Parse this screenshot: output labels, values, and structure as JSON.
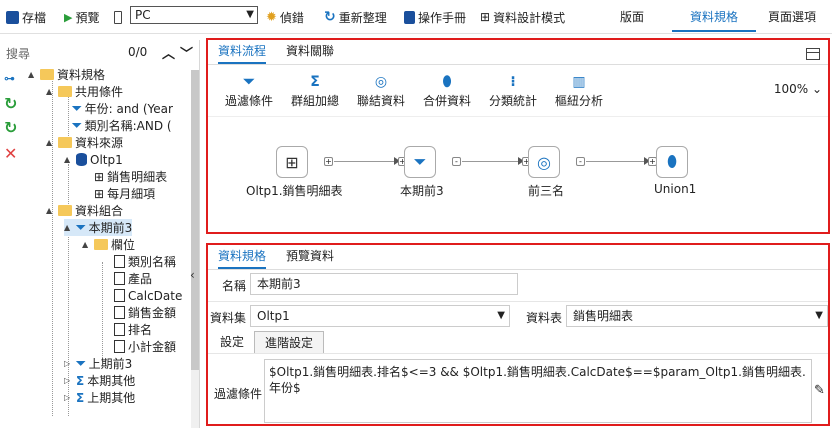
{
  "toolbar": {
    "save": "存檔",
    "preview": "預覽",
    "device": "PC",
    "debug": "偵錯",
    "refresh": "重新整理",
    "manual": "操作手冊",
    "design_mode": "資料設計模式",
    "right_tabs": [
      "版面",
      "資料規格",
      "頁面選項"
    ]
  },
  "left": {
    "search_placeholder": "搜尋",
    "count": "0/0",
    "tree": {
      "root": "資料規格",
      "common": "共用條件",
      "cond1": "年份: and (Year",
      "cond2": "類別名稱:AND (",
      "source": "資料來源",
      "oltp": "Oltp1",
      "table1": "銷售明細表",
      "table2": "每月細項",
      "combo": "資料組合",
      "top3": "本期前3",
      "fields": "欄位",
      "f1": "類別名稱",
      "f2": "產品",
      "f3": "CalcDate",
      "f4": "銷售金額",
      "f5": "排名",
      "f6": "小計金額",
      "prev3": "上期前3",
      "other": "本期其他",
      "prevother": "上期其他"
    }
  },
  "flow_panel": {
    "tabs": [
      "資料流程",
      "資料關聯"
    ],
    "tools": [
      "過濾條件",
      "群組加總",
      "聯結資料",
      "合併資料",
      "分類統計",
      "樞紐分析"
    ],
    "zoom": "100%",
    "nodes": [
      "Oltp1.銷售明細表",
      "本期前3",
      "前三名",
      "Union1"
    ]
  },
  "spec_panel": {
    "tabs": [
      "資料規格",
      "預覽資料"
    ],
    "name_label": "名稱",
    "name_value": "本期前3",
    "dataset_label": "資料集",
    "dataset_value": "Oltp1",
    "table_label": "資料表",
    "table_value": "銷售明細表",
    "sub_tabs": [
      "設定",
      "進階設定"
    ],
    "filter_label": "過濾條件",
    "filter_value": "$Oltp1.銷售明細表.排名$<=3 && $Oltp1.銷售明細表.CalcDate$==$param_Oltp1.銷售明細表.年份$"
  },
  "colors": {
    "accent": "#1a73c0",
    "highlight_border": "#e01c1c"
  }
}
